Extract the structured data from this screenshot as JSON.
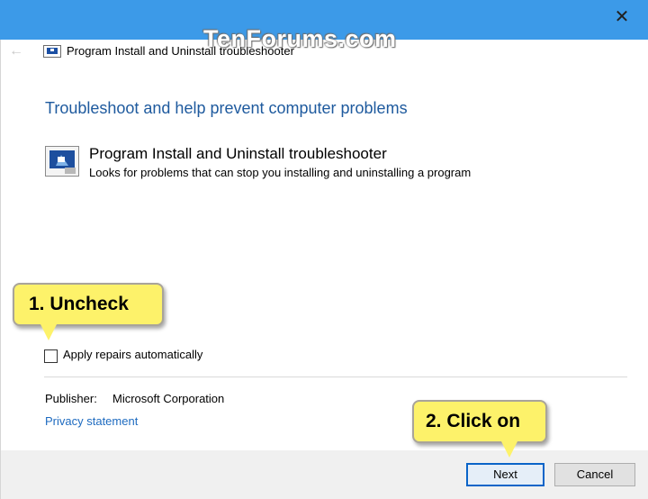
{
  "window": {
    "title": "Program Install and Uninstall troubleshooter",
    "close_glyph": "✕",
    "back_glyph": "←"
  },
  "watermark": "TenForums.com",
  "main": {
    "heading": "Troubleshoot and help prevent computer problems",
    "item": {
      "title": "Program Install and Uninstall troubleshooter",
      "description": "Looks for problems that can stop you installing and uninstalling a program",
      "icon": "troubleshooter-icon"
    },
    "options": {
      "apply_repairs_label": "Apply repairs automatically",
      "apply_repairs_checked": false
    },
    "publisher": {
      "label": "Publisher:",
      "value": "Microsoft Corporation"
    },
    "privacy_link": "Privacy statement"
  },
  "footer": {
    "next_label": "Next",
    "cancel_label": "Cancel"
  },
  "callouts": {
    "step1": "1. Uncheck",
    "step2": "2. Click on"
  },
  "colors": {
    "titlebar_blue": "#3c9ae8",
    "heading_blue": "#1e5a9e",
    "link_blue": "#1e6bc0",
    "callout_yellow": "#fdf26a",
    "footer_gray": "#f0f0f0"
  }
}
